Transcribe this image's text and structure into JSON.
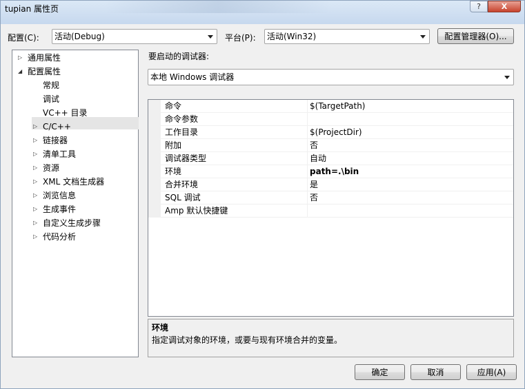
{
  "window": {
    "title": "tupian 属性页"
  },
  "titlebar": {
    "help_label": "?",
    "close_label": "X"
  },
  "config": {
    "config_label": "配置(C):",
    "config_value": "活动(Debug)",
    "platform_label": "平台(P):",
    "platform_value": "活动(Win32)",
    "manager_button": "配置管理器(O)..."
  },
  "tree": {
    "items": [
      {
        "label": "通用属性",
        "twisty": "▷"
      },
      {
        "label": "配置属性",
        "twisty": "◢"
      },
      {
        "label": "常规",
        "twisty": ""
      },
      {
        "label": "调试",
        "twisty": ""
      },
      {
        "label": "VC++ 目录",
        "twisty": ""
      },
      {
        "label": "C/C++",
        "twisty": "▷"
      },
      {
        "label": "链接器",
        "twisty": "▷"
      },
      {
        "label": "清单工具",
        "twisty": "▷"
      },
      {
        "label": "资源",
        "twisty": "▷"
      },
      {
        "label": "XML 文档生成器",
        "twisty": "▷"
      },
      {
        "label": "浏览信息",
        "twisty": "▷"
      },
      {
        "label": "生成事件",
        "twisty": "▷"
      },
      {
        "label": "自定义生成步骤",
        "twisty": "▷"
      },
      {
        "label": "代码分析",
        "twisty": "▷"
      }
    ],
    "selected_index": 3
  },
  "debugger": {
    "label": "要启动的调试器:",
    "value": "本地 Windows 调试器"
  },
  "properties": {
    "rows": [
      {
        "name": "命令",
        "value": "$(TargetPath)"
      },
      {
        "name": "命令参数",
        "value": ""
      },
      {
        "name": "工作目录",
        "value": "$(ProjectDir)"
      },
      {
        "name": "附加",
        "value": "否"
      },
      {
        "name": "调试器类型",
        "value": "自动"
      },
      {
        "name": "环境",
        "value": "path=.\\bin"
      },
      {
        "name": "合并环境",
        "value": "是"
      },
      {
        "name": "SQL 调试",
        "value": "否"
      },
      {
        "name": "Amp 默认快捷键",
        "value": ""
      }
    ],
    "bold_row_index": 5
  },
  "description": {
    "title": "环境",
    "text": "指定调试对象的环境，或要与现有环境合并的变量。"
  },
  "buttons": {
    "ok": "确定",
    "cancel": "取消",
    "apply": "应用(A)"
  }
}
